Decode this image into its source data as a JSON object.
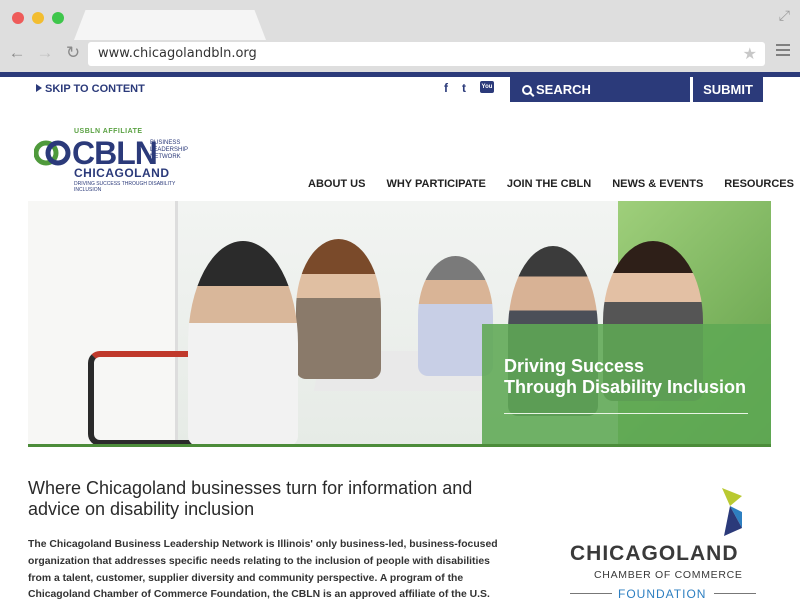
{
  "browser": {
    "url": "www.chicagolandbln.org"
  },
  "header": {
    "skip_label": "SKIP TO CONTENT",
    "social": [
      "f",
      "t",
      "You"
    ],
    "search_label": "SEARCH",
    "submit_label": "SUBMIT"
  },
  "logo": {
    "affiliate": "USBLN AFFILIATE",
    "acronym": "CBLN",
    "full_name_1": "BUSINESS",
    "full_name_2": "LEADERSHIP",
    "full_name_3": "NETWORK",
    "region": "CHICAGOLAND",
    "tagline": "DRIVING SUCCESS THROUGH DISABILITY INCLUSION"
  },
  "nav": {
    "items": [
      "ABOUT US",
      "WHY PARTICIPATE",
      "JOIN THE CBLN",
      "NEWS & EVENTS",
      "RESOURCES"
    ]
  },
  "hero": {
    "line1": "Driving Success",
    "line2": "Through Disability Inclusion"
  },
  "content": {
    "headline": "Where Chicagoland businesses turn for information and advice on disability inclusion",
    "paragraph": "The Chicagoland Business Leadership Network is Illinois' only business-led, business-focused organization that addresses specific needs relating to the inclusion of people with disabilities from a talent, customer, supplier diversity and community perspective.  A program of the Chicagoland Chamber of Commerce Foundation, the CBLN is an approved affiliate of the U.S. Business"
  },
  "chamber": {
    "name": "CHICAGOLAND",
    "sub": "CHAMBER OF COMMERCE",
    "foundation": "FOUNDATION"
  },
  "colors": {
    "brand_navy": "#2b3a7a",
    "brand_green": "#5ea854"
  }
}
